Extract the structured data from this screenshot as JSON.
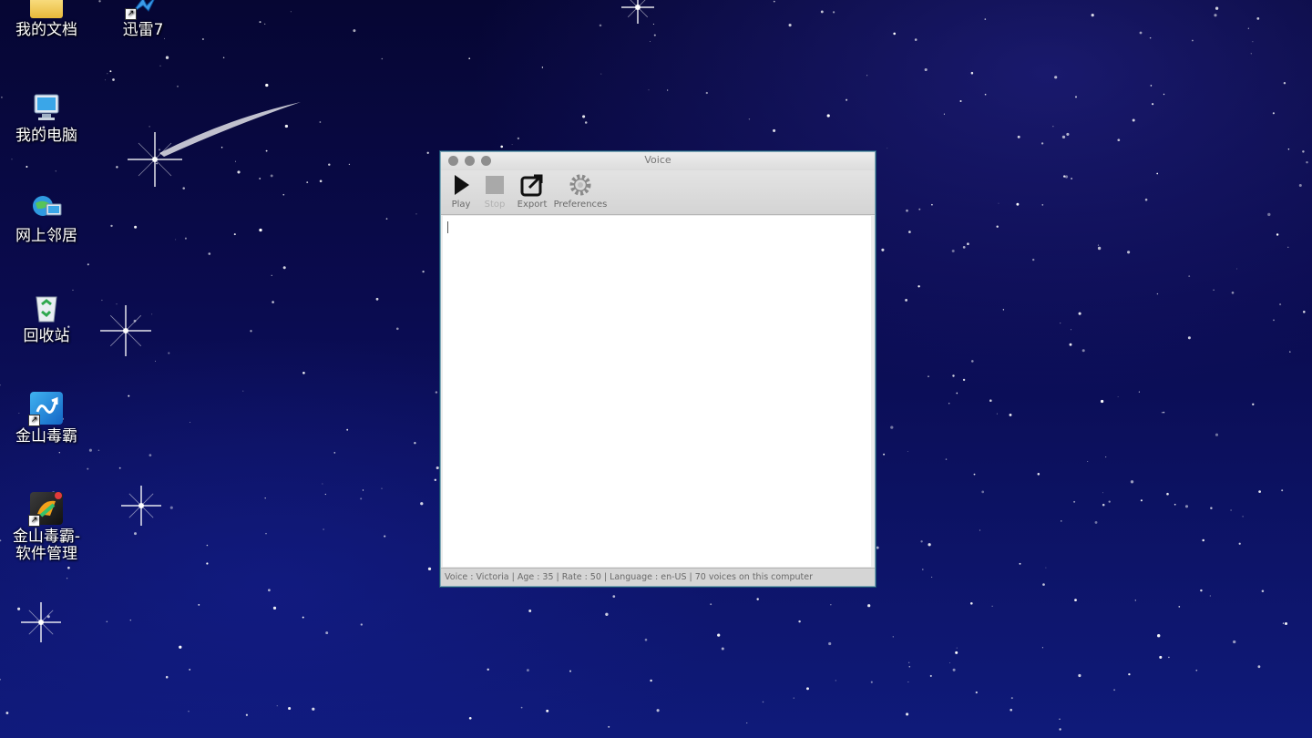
{
  "desktop": {
    "icons": [
      {
        "label": "我的文档",
        "icon": "folder-icon"
      },
      {
        "label": "迅雷7",
        "icon": "thunder-bird-icon"
      },
      {
        "label": "我的电脑",
        "icon": "computer-icon"
      },
      {
        "label": "网上邻居",
        "icon": "network-icon"
      },
      {
        "label": "回收站",
        "icon": "recycle-bin-icon"
      },
      {
        "label": "金山毒霸",
        "icon": "kingsoft-antivirus-icon"
      },
      {
        "label_line1": "金山毒霸-",
        "label_line2": "软件管理",
        "icon": "software-manager-icon"
      }
    ]
  },
  "window": {
    "title": "Voice",
    "toolbar": {
      "play_label": "Play",
      "stop_label": "Stop",
      "export_label": "Export",
      "preferences_label": "Preferences"
    },
    "editor": {
      "value": ""
    },
    "status": "Voice : Victoria  |  Age : 35  |  Rate : 50  |  Language : en-US  |  70 voices on this computer"
  },
  "colors": {
    "desktop_bg": "#0a0b4e",
    "window_border": "#7fa9b9",
    "toolbar_bg": "#d4d4d4"
  }
}
